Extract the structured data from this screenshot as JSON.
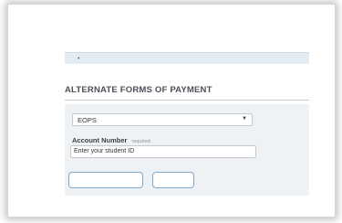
{
  "header": {
    "bar_text": "•"
  },
  "section": {
    "title": "ALTERNATE FORMS OF PAYMENT"
  },
  "payment_method": {
    "selected": "EOPS"
  },
  "account": {
    "label": "Account Number",
    "required": "required",
    "placeholder": "Enter your student ID"
  },
  "buttons": {
    "primary_label": "",
    "secondary_label": ""
  },
  "colors": {
    "accent": "#7fa8cf",
    "panel": "#eef2f5",
    "bar": "#e2ecf3"
  }
}
